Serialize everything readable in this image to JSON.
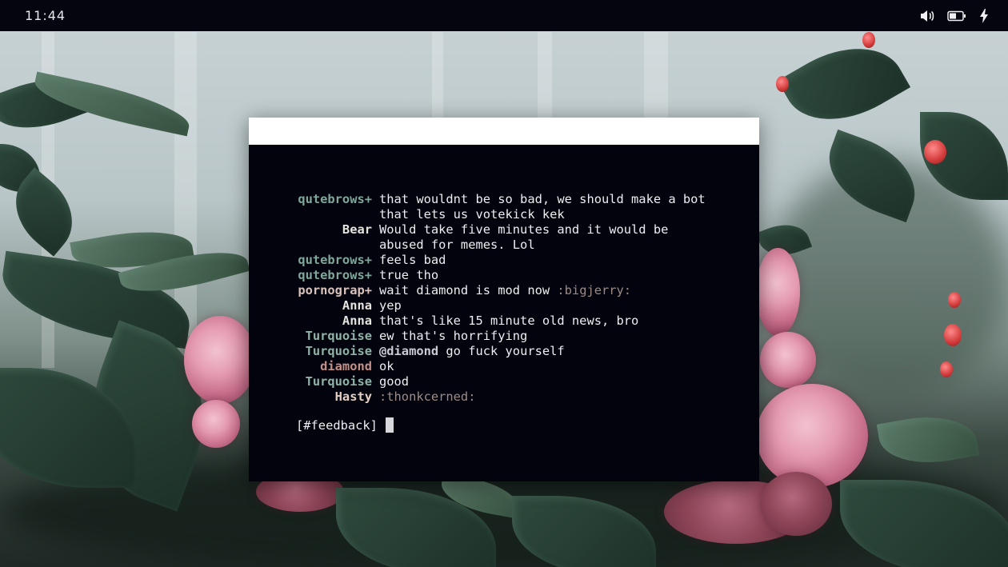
{
  "statusbar": {
    "time": "11:44",
    "icons": [
      "volume-icon",
      "battery-icon",
      "charging-bolt-icon"
    ]
  },
  "terminal": {
    "nick_colors": {
      "qutebrows": "#7fa89a",
      "bear": "#e6e4de",
      "pornograp": "#d9c2bb",
      "anna": "#e6e4de",
      "turquoise": "#8fb3a6",
      "diamond": "#c48f86",
      "hasty": "#e5cfc2"
    },
    "messages": [
      {
        "nick": "qutebrows+",
        "color_key": "qutebrows",
        "lines": [
          "that wouldnt be so bad, we should make a bot",
          "that lets us votekick kek"
        ]
      },
      {
        "nick": "Bear",
        "color_key": "bear",
        "lines": [
          "Would take five minutes and it would be",
          "abused for memes. Lol"
        ]
      },
      {
        "nick": "qutebrows+",
        "color_key": "qutebrows",
        "lines": [
          "feels bad"
        ]
      },
      {
        "nick": "qutebrows+",
        "color_key": "qutebrows",
        "lines": [
          "true tho"
        ]
      },
      {
        "nick": "pornograp+",
        "color_key": "pornograp",
        "text": "wait diamond is mod now ",
        "emoji": ":bigjerry:"
      },
      {
        "nick": "Anna",
        "color_key": "anna",
        "lines": [
          "yep"
        ]
      },
      {
        "nick": "Anna",
        "color_key": "anna",
        "lines": [
          "that's like 15 minute old news, bro"
        ]
      },
      {
        "nick": "Turquoise",
        "color_key": "turquoise",
        "lines": [
          "ew that's horrifying"
        ]
      },
      {
        "nick": "Turquoise",
        "color_key": "turquoise",
        "mention": "@diamond",
        "text": " go fuck yourself"
      },
      {
        "nick": "diamond",
        "color_key": "diamond",
        "lines": [
          "ok"
        ]
      },
      {
        "nick": "Turquoise",
        "color_key": "turquoise",
        "lines": [
          "good"
        ]
      },
      {
        "nick": "Hasty",
        "color_key": "hasty",
        "emoji": ":thonkcerned:"
      }
    ],
    "prompt": "[#feedback]"
  }
}
